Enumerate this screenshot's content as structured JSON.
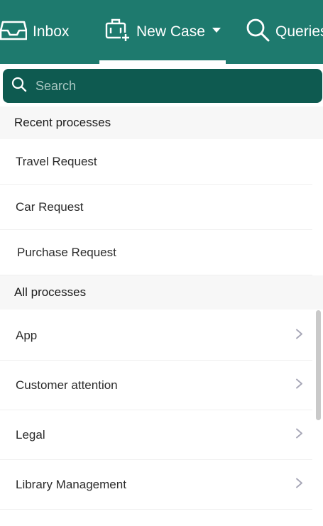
{
  "nav": {
    "inbox": {
      "label": "Inbox",
      "icon": "inbox-tray-icon"
    },
    "new_case": {
      "label": "New Case",
      "icon": "new-case-briefcase-plus-icon"
    },
    "queries": {
      "label": "Queries",
      "icon": "search-icon"
    },
    "active": "new_case"
  },
  "search": {
    "placeholder": "Search",
    "value": ""
  },
  "recent": {
    "header": "Recent processes",
    "items": [
      {
        "label": "Travel Request"
      },
      {
        "label": "Car Request"
      },
      {
        "label": "Purchase Request"
      }
    ]
  },
  "all": {
    "header": "All processes",
    "items": [
      {
        "label": "App",
        "icon": "chevron-right-icon"
      },
      {
        "label": "Customer attention",
        "icon": "chevron-right-icon"
      },
      {
        "label": "Legal",
        "icon": "chevron-right-icon"
      },
      {
        "label": "Library Management",
        "icon": "chevron-right-icon"
      }
    ]
  },
  "colors": {
    "brand": "#1e7a6e",
    "search_bg": "#0e5a50",
    "section_bg": "#f7f7f7",
    "chevron": "#a8a8b8"
  }
}
